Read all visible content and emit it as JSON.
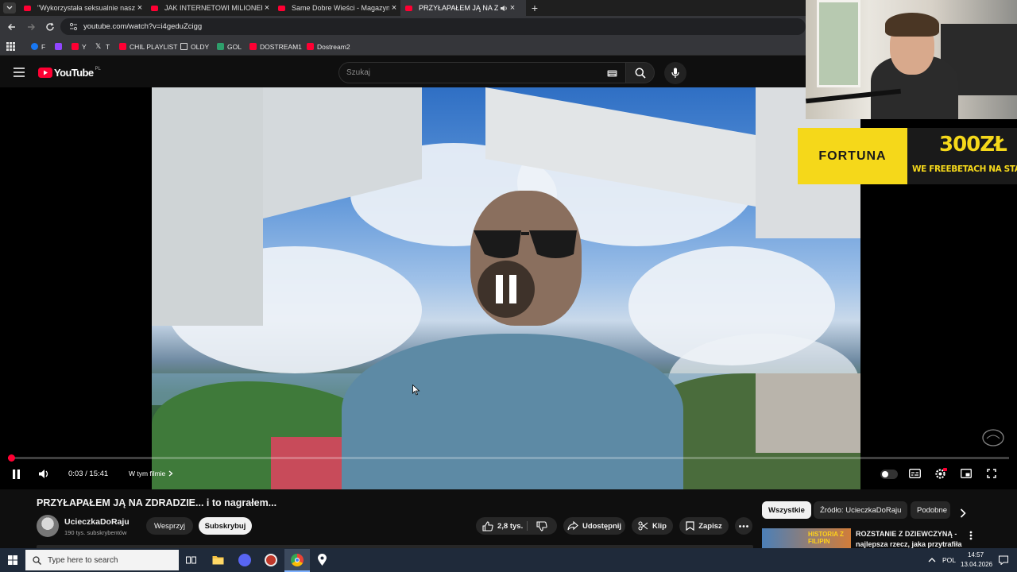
{
  "browser": {
    "tabs": [
      {
        "title": "\"Wykorzystała seksualnie naszą",
        "active": false
      },
      {
        "title": "JAK INTERNETOWI MILIONERZY",
        "active": false
      },
      {
        "title": "Same Dobre Wieści - Magazyn",
        "active": false
      },
      {
        "title": "PRZYŁAPAŁEM JĄ NA ZDRADZIE",
        "active": true
      }
    ],
    "url": "youtube.com/watch?v=i4geduZcigg",
    "bookmarks": [
      "F",
      "Y",
      "T",
      "CHIL PLAYLIST",
      "OLDY",
      "GOL",
      "DOSTREAM1",
      "Dostream2"
    ]
  },
  "youtube": {
    "logo": "YouTube",
    "region": "PL",
    "search_placeholder": "Szukaj",
    "player": {
      "time_current": "0:03",
      "time_total": "15:41",
      "time_display": "0:03 / 15:41",
      "chapter_label": "W tym filmie",
      "progress_fraction": 0.0032
    },
    "video": {
      "title": "PRZYŁAPAŁEM JĄ NA ZDRADZIE... i to nagrałem...",
      "channel": "UcieczkaDoRaju",
      "subscribers": "190 tys. subskrybentów",
      "support_label": "Wesprzyj",
      "subscribe_label": "Subskrybuj",
      "likes": "2,8 tys.",
      "share_label": "Udostępnij",
      "clip_label": "Klip",
      "save_label": "Zapisz"
    },
    "chips": [
      "Wszystkie",
      "Źródło: UcieczkaDoRaju",
      "Podobne"
    ],
    "recommended": {
      "thumb_text": "HISTORIA Z FILIPIN",
      "title_line1": "ROZSTANIE Z DZIEWCZYNĄ -",
      "title_line2": "najlepsza rzecz, jaka przytrafiła..."
    }
  },
  "overlay": {
    "ad_brand": "FORTUNA",
    "ad_amount": "300ZŁ",
    "ad_tagline": "WE FREEBETACH NA START"
  },
  "taskbar": {
    "search_placeholder": "Type here to search",
    "language": "POL",
    "time": "14:57",
    "date": "13.04.2026"
  },
  "colors": {
    "yt_red": "#ff0033",
    "fortuna_yellow": "#f5d81a",
    "bg": "#0f0f0f"
  }
}
